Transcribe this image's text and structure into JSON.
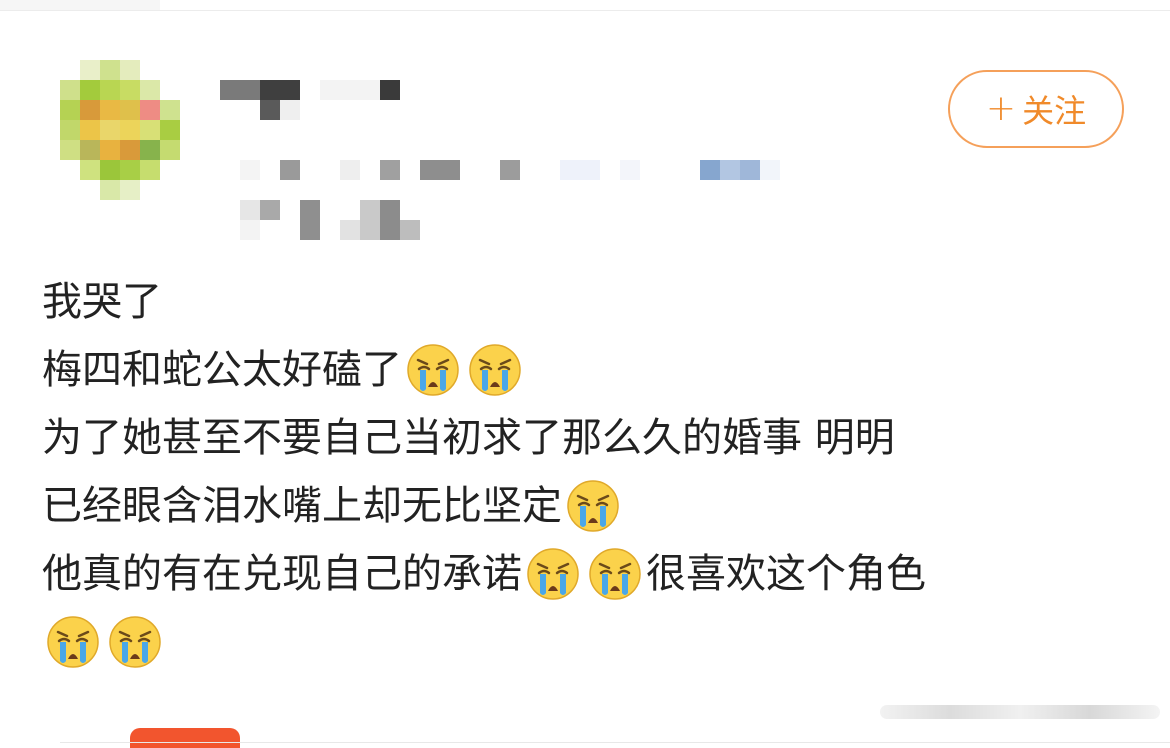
{
  "post": {
    "lines": [
      "我哭了",
      "梅四和蛇公太好磕了",
      "为了她甚至不要自己当初求了那么久的婚事 明明",
      "已经眼含泪水嘴上却无比坚定",
      "他真的有在兑现自己的承诺",
      "很喜欢这个角色"
    ],
    "emoji": "crying-face-emoji"
  },
  "follow_button": {
    "plus": "+",
    "label": "关注"
  },
  "colors": {
    "accent": "#f08a2a",
    "accent_border": "#f5a05a",
    "text": "#222222",
    "emoji_face": "#fbd24b",
    "emoji_tear": "#4aa7e8"
  }
}
